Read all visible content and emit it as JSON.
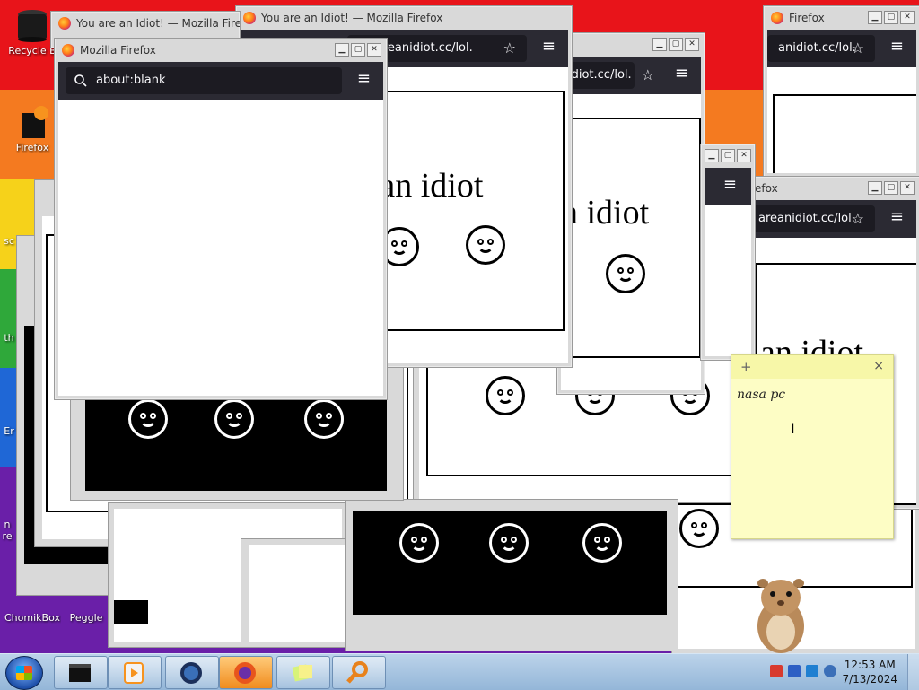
{
  "desktop": {
    "icons": [
      {
        "label": "Recycle B"
      },
      {
        "label": "Firefox"
      },
      {
        "label": "sc"
      },
      {
        "label": "th"
      },
      {
        "label": "Er"
      },
      {
        "label": "n"
      },
      {
        "label": "re"
      },
      {
        "label": "ChomikBox"
      },
      {
        "label": "Peggle"
      }
    ]
  },
  "windows": {
    "front": {
      "title": "Mozilla Firefox",
      "url": "about:blank"
    },
    "behind_title": {
      "title": "You are an Idiot! — Mozilla Firefox"
    },
    "idiot_a": {
      "title": "You are an Idiot! — Mozilla Firefox",
      "url": "youareanidiot.cc/lol.",
      "text": "e an idiot"
    },
    "idiot_b": {
      "url": "idiot.cc/lol.",
      "text": "n idiot"
    },
    "idiot_c": {
      "title": "Firefox",
      "url": "anidiot.cc/lol."
    },
    "idiot_d": {
      "title": "efox",
      "url": "areanidiot.cc/lol.",
      "text": "an idiot"
    }
  },
  "sticky_note": {
    "add_label": "+",
    "close_label": "×",
    "text": "nasa pc",
    "cursor_glyph": "I"
  },
  "taskbar": {
    "clock_time": "12:53 AM",
    "clock_date": "7/13/2024",
    "buttons": [
      "terminal-icon",
      "media-player-icon",
      "browser-globe-icon",
      "firefox-icon",
      "sticky-notes-icon",
      "search-magnifier-icon"
    ]
  },
  "window_controls": {
    "minimize": "▁",
    "maximize": "▢",
    "close": "✕"
  },
  "colors": {
    "firefox_toolbar": "#2b2a33",
    "urlbar": "#1c1b22",
    "sticky": "#fdfdc5"
  }
}
